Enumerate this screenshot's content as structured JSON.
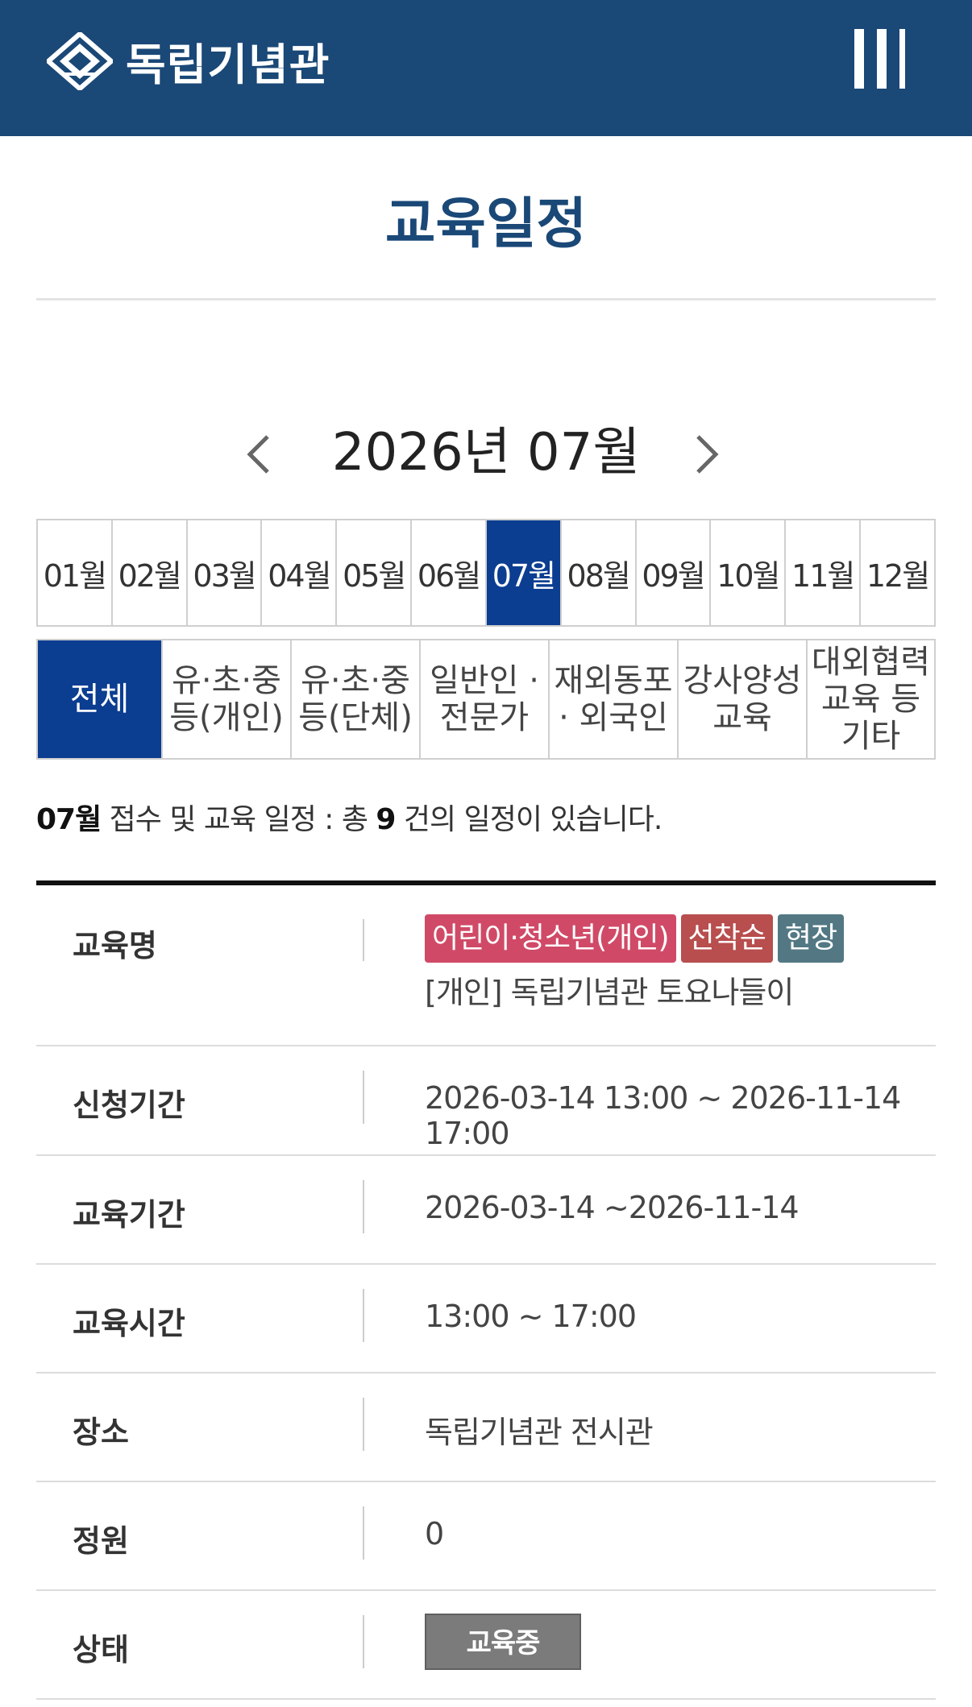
{
  "header": {
    "logo_text": "독립기념관",
    "bg_color": "#1a4877",
    "menu_icon": "menu-icon"
  },
  "page": {
    "title": "교육일정"
  },
  "month_nav": {
    "label": "2026년 07월",
    "prev_icon": "chevron-left-icon",
    "next_icon": "chevron-right-icon"
  },
  "months": [
    "01월",
    "02월",
    "03월",
    "04월",
    "05월",
    "06월",
    "07월",
    "08월",
    "09월",
    "10월",
    "11월",
    "12월"
  ],
  "active_month_index": 6,
  "categories": [
    "전체",
    "유·초·중\n등(개인)",
    "유·초·중\n등(단체)",
    "일반인 ·\n전문가",
    "재외동포\n· 외국인",
    "강사양성\n교육",
    "대외협력\n교육 등\n기타"
  ],
  "active_category_index": 0,
  "accent_color": "#0b3d91",
  "summary": {
    "month": "07월",
    "middle": " 접수 및 교육 일정 : 총 ",
    "count": "9",
    "suffix": " 건의 일정이 있습니다."
  },
  "course": {
    "labels": {
      "name": "교육명",
      "apply_period": "신청기간",
      "edu_period": "교육기간",
      "edu_time": "교육시간",
      "place": "장소",
      "capacity": "정원",
      "status": "상태"
    },
    "badges": [
      {
        "text": "어린이·청소년(개인)",
        "color": "#d04a67"
      },
      {
        "text": "선착순",
        "color": "#b84e4e"
      },
      {
        "text": "현장",
        "color": "#537884"
      }
    ],
    "title": "[개인] 독립기념관 토요나들이",
    "apply_period": "2026-03-14 13:00 ~ 2026-11-14 17:00",
    "edu_period": "2026-03-14 ~2026-11-14",
    "edu_time": "13:00 ~ 17:00",
    "place": "독립기념관 전시관",
    "capacity": "0",
    "status": "교육중"
  }
}
